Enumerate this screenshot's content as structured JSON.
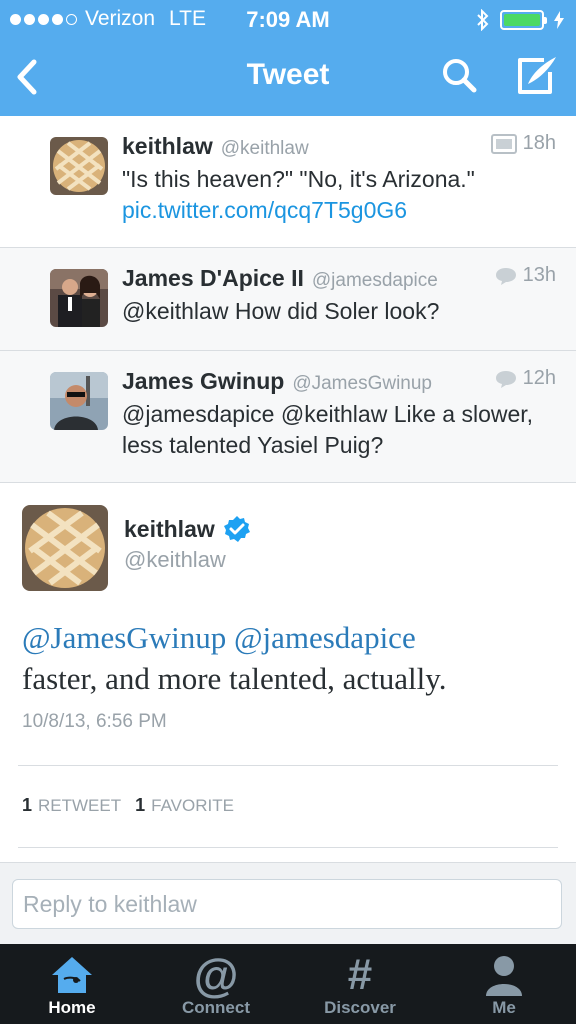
{
  "status_bar": {
    "carrier": "Verizon",
    "network": "LTE",
    "time": "7:09 AM"
  },
  "nav": {
    "title": "Tweet",
    "icons": [
      "back-chevron-icon",
      "search-icon",
      "compose-icon"
    ]
  },
  "conversation": [
    {
      "name": "keithlaw",
      "handle": "@keithlaw",
      "time": "18h",
      "meta_icon": "image-icon",
      "text": "\"Is this heaven?\" \"No, it's Arizona.\"",
      "link": "pic.twitter.com/qcq7T5g0G6"
    },
    {
      "name": "James D'Apice II",
      "handle": "@jamesdapice",
      "time": "13h",
      "meta_icon": "reply-bubble-icon",
      "text": "@keithlaw How did Soler look?"
    },
    {
      "name": "James Gwinup",
      "handle": "@JamesGwinup",
      "time": "12h",
      "meta_icon": "reply-bubble-icon",
      "text": "@jamesdapice @keithlaw Like a slower, less talented Yasiel Puig?"
    }
  ],
  "main_tweet": {
    "name": "keithlaw",
    "handle": "@keithlaw",
    "mention1": "@JamesGwinup",
    "mention2": "@jamesdapice",
    "text": "faster, and more talented, actually.",
    "date": "10/8/13, 6:56 PM",
    "retweets_count": "1",
    "retweets_label": "RETWEET",
    "favorites_count": "1",
    "favorites_label": "FAVORITE"
  },
  "reply": {
    "placeholder": "Reply to keithlaw"
  },
  "tabbar": {
    "tabs": [
      {
        "label": "Home",
        "icon": "home-icon",
        "active": true
      },
      {
        "label": "Connect",
        "icon": "at-icon",
        "active": false
      },
      {
        "label": "Discover",
        "icon": "hash-icon",
        "active": false
      },
      {
        "label": "Me",
        "icon": "person-icon",
        "active": false
      }
    ]
  },
  "colors": {
    "brand": "#55acee",
    "link": "#1b95e0",
    "verified": "#1da1f2",
    "tabbar": "#161a1d"
  }
}
